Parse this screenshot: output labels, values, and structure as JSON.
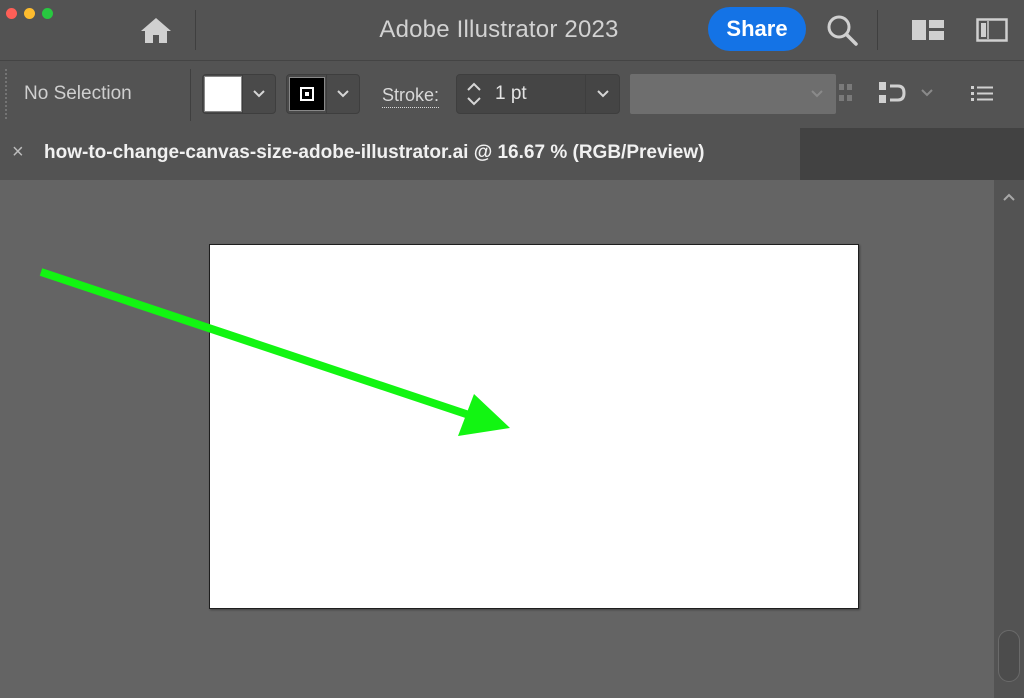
{
  "window": {
    "title": "Adobe Illustrator 2023",
    "share_label": "Share"
  },
  "icons": {
    "home": "home-icon",
    "search": "search-icon",
    "workspace": "workspace-switcher-icon",
    "panel": "panel-toggle-icon",
    "align": "align-icon",
    "distribute": "distribute-icon",
    "menu": "list-menu-icon"
  },
  "control_bar": {
    "selection_label": "No Selection",
    "fill_color": "#ffffff",
    "stroke_color": "#000000",
    "stroke_label": "Stroke:",
    "stroke_weight": "1 pt"
  },
  "document": {
    "tab_close": "×",
    "tab_title": "how-to-change-canvas-size-adobe-illustrator.ai @ 16.67 % (RGB/Preview)"
  },
  "canvas": {
    "artboard_color": "#ffffff",
    "annotation_arrow_color": "#12f512",
    "background_color": "#646464"
  },
  "colors": {
    "traffic_close": "#fe5f57",
    "traffic_minimize": "#febc2e",
    "traffic_zoom": "#28c840",
    "accent": "#1473e6"
  }
}
